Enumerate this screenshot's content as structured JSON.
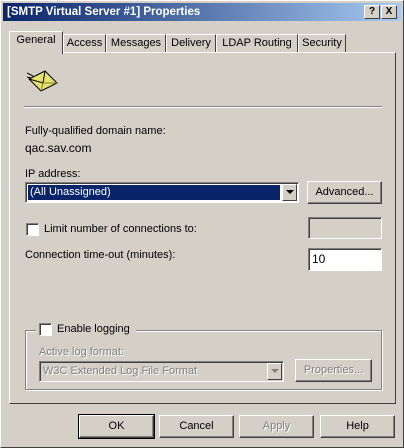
{
  "window": {
    "title": "[SMTP Virtual Server #1] Properties",
    "help_glyph": "?",
    "close_glyph": "X"
  },
  "tabs": [
    {
      "label": "General"
    },
    {
      "label": "Access"
    },
    {
      "label": "Messages"
    },
    {
      "label": "Delivery"
    },
    {
      "label": "LDAP Routing"
    },
    {
      "label": "Security"
    }
  ],
  "general": {
    "icon": "smtp-envelope-icon",
    "fqdn_label": "Fully-qualified domain name:",
    "fqdn_value": "qac.sav.com",
    "ip_label": "IP address:",
    "ip_value": "(All Unassigned)",
    "advanced_button": "Advanced...",
    "limit_label": "Limit number of connections to:",
    "limit_checked": false,
    "limit_value": "",
    "timeout_label": "Connection time-out (minutes):",
    "timeout_value": "10",
    "logging": {
      "label": "Enable logging",
      "checked": false,
      "format_label": "Active log format:",
      "format_value": "W3C Extended Log File Format",
      "properties_button": "Properties..."
    }
  },
  "footer": {
    "ok": "OK",
    "cancel": "Cancel",
    "apply": "Apply",
    "help": "Help"
  },
  "colors": {
    "title_gradient_start": "#0a246a",
    "title_gradient_end": "#a6caf0",
    "selection": "#0a246a",
    "face": "#d4d0c8"
  }
}
